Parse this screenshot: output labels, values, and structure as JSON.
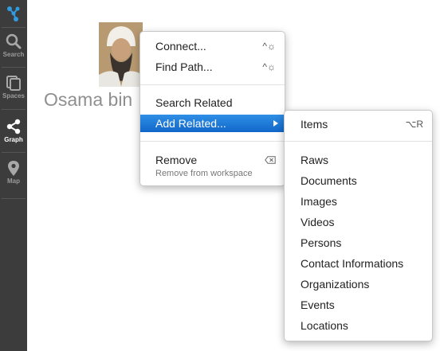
{
  "sidebar": {
    "items": [
      {
        "label": "Search",
        "icon": "search-icon"
      },
      {
        "label": "Spaces",
        "icon": "spaces-icon"
      },
      {
        "label": "Graph",
        "icon": "graph-icon",
        "active": true
      },
      {
        "label": "Map",
        "icon": "map-pin-icon"
      }
    ]
  },
  "graph": {
    "node": {
      "label": "Osama bin"
    }
  },
  "context_menu": {
    "items": [
      {
        "label": "Connect...",
        "shortcut": "^☼"
      },
      {
        "label": "Find Path...",
        "shortcut": "^☼"
      },
      {
        "label": "Search Related"
      },
      {
        "label": "Add Related...",
        "highlighted": true
      },
      {
        "label": "Remove",
        "sublabel": "Remove from workspace"
      }
    ]
  },
  "submenu": {
    "header": {
      "label": "Items",
      "shortcut": "⌥R"
    },
    "items": [
      "Raws",
      "Documents",
      "Images",
      "Videos",
      "Persons",
      "Contact Informations",
      "Organizations",
      "Events",
      "Locations"
    ]
  },
  "colors": {
    "sidebar_bg": "#3c3c3c",
    "highlight": "#1a75d8",
    "logo": "#2f9be0"
  }
}
